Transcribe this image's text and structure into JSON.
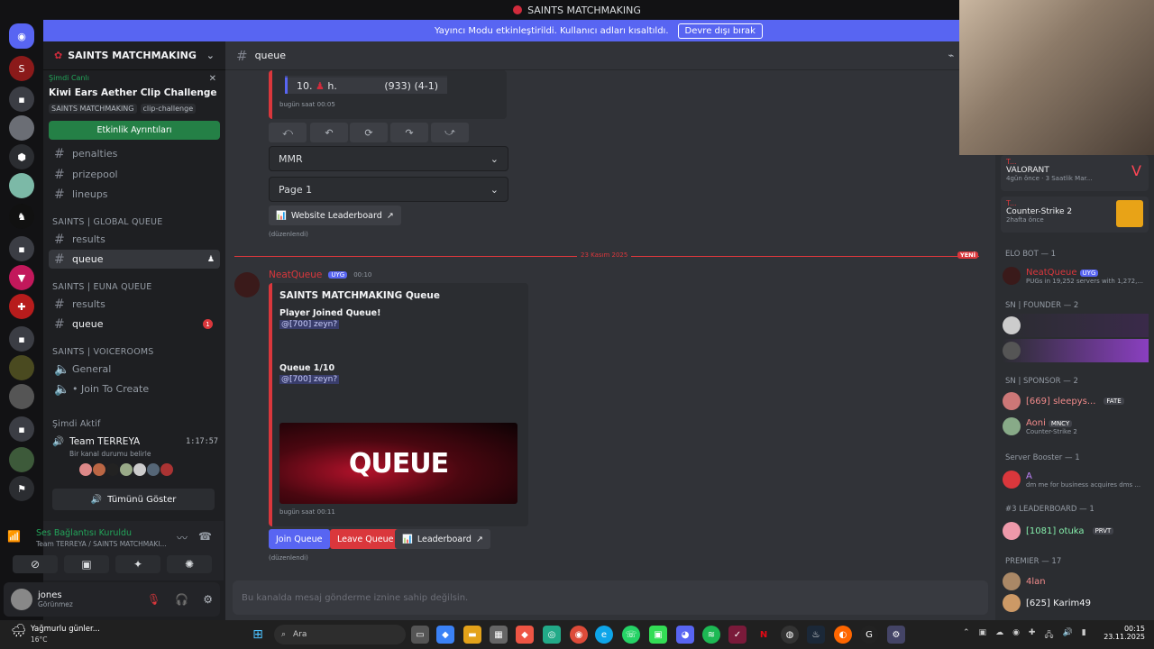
{
  "window": {
    "title": "SAINTS MATCHMAKING"
  },
  "banner": {
    "text": "Yayıncı Modu etkinleştirildi. Kullanıcı adları kısaltıldı.",
    "button": "Devre dışı bırak"
  },
  "server": {
    "name": "SAINTS MATCHMAKING"
  },
  "event": {
    "live_label": "Şimdi Canlı",
    "title": "Kiwi Ears Aether Clip Challenge",
    "server_tag": "SAINTS MATCHMAKING",
    "channel_tag": "clip-challenge",
    "button": "Etkinlik Ayrıntıları"
  },
  "channels_top": [
    "penalties",
    "prizepool",
    "lineups"
  ],
  "categories": {
    "global": "SAINTS | GLOBAL QUEUE",
    "euna": "SAINTS | EUNA QUEUE",
    "voice": "SAINTS | VOICEROOMS"
  },
  "global_channels": [
    "results",
    "queue"
  ],
  "euna_channels": [
    "results",
    "queue"
  ],
  "euna_badge": "1",
  "voice_channels": [
    "General",
    "• Join To Create"
  ],
  "now_active": {
    "label": "Şimdi Aktif",
    "team": "Team TERREYA",
    "time": "1:17:57",
    "status": "Bir kanal durumu belirle",
    "show_all": "Tümünü Göster"
  },
  "voice_connection": {
    "status": "Ses Bağlantısı Kuruldu",
    "location": "Team TERREYA / SAINTS MATCHMAKI..."
  },
  "user": {
    "name": "jones",
    "status": "Görünmez"
  },
  "channel_header": {
    "name": "queue"
  },
  "leaderboard_embed": {
    "row_name": "10.",
    "row_user": "h.",
    "row_stats": "(933) (4-1)",
    "timestamp": "bugün saat 00:05",
    "select_mmr": "MMR",
    "select_page": "Page 1",
    "website_btn": "Website Leaderboard",
    "edited": "(düzenlendi)"
  },
  "date_divider": {
    "date": "23 Kasım 2025",
    "new_label": "YENİ"
  },
  "message": {
    "author": "NeatQueue",
    "app_tag": "UYG",
    "time": "00:10",
    "embed_title": "SAINTS MATCHMAKING Queue",
    "joined_label": "Player Joined Queue!",
    "joined_mention": "@[700] zeyn?",
    "queue_label": "Queue 1/10",
    "queue_mention": "@[700] zeyn?",
    "banner_text": "QUEUE",
    "embed_time": "bugün saat 00:11",
    "join_btn": "Join Queue",
    "leave_btn": "Leave Queue",
    "leaderboard_btn": "Leaderboard",
    "edited": "(düzenlendi)"
  },
  "input": {
    "placeholder": "Bu kanalda mesaj gönderme iznine sahip değilsin."
  },
  "activities": [
    {
      "name": "T...",
      "game": "VALORANT",
      "sub1": "4gün önce",
      "sub2": "3 Saatlik Mar..."
    },
    {
      "name": "T...",
      "game": "Counter-Strike 2",
      "sub1": "2hafta önce"
    }
  ],
  "members": {
    "elo_cat": "ELO BOT — 1",
    "elo_name": "NeatQueue",
    "elo_tag": "UYG",
    "elo_sub": "PUGs in 19,252 servers with 1,272,...",
    "founder_cat": "SN | FOUNDER — 2",
    "sponsor_cat": "SN | SPONSOR — 2",
    "sponsor1": "[669] sleepys...",
    "sponsor1_tag": "FATE",
    "sponsor2": "Aoni",
    "sponsor2_tag": "MNCY",
    "sponsor2_sub": "Counter-Strike 2",
    "booster_cat": "Server Booster — 1",
    "booster_name": "A",
    "booster_sub": "dm me for business acquires dms ...",
    "lb_cat": "#3 LEADERBOARD — 1",
    "lb_name": "[1081] otuka",
    "lb_tag": "PRVT",
    "premier_cat": "PREMIER — 17",
    "premier1": "4lan",
    "premier2": "[625] Karim49"
  },
  "taskbar": {
    "weather": "Yağmurlu günler...",
    "temp": "16°C",
    "search": "Ara",
    "time": "00:15",
    "date": "23.11.2025"
  },
  "colors": {
    "accent": "#5865f2",
    "danger": "#da373c",
    "success": "#248046",
    "bg": "#313338"
  }
}
